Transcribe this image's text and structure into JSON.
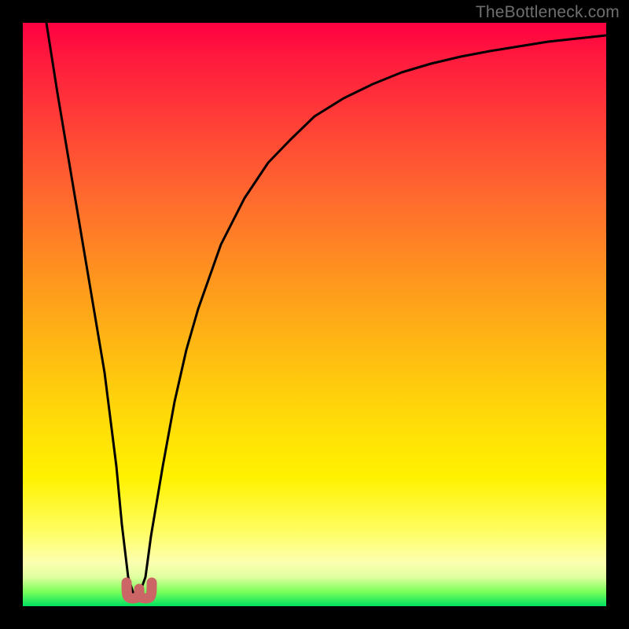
{
  "watermark": "TheBottleneck.com",
  "chart_data": {
    "type": "line",
    "title": "",
    "xlabel": "",
    "ylabel": "",
    "xlim": [
      0,
      100
    ],
    "ylim": [
      0,
      100
    ],
    "grid": false,
    "legend": false,
    "series": [
      {
        "name": "bottleneck-curve",
        "x": [
          4,
          6,
          8,
          10,
          12,
          14,
          16,
          17,
          18,
          19,
          20,
          21,
          22,
          24,
          26,
          28,
          30,
          34,
          38,
          42,
          46,
          50,
          55,
          60,
          65,
          70,
          75,
          80,
          85,
          90,
          95,
          100
        ],
        "y": [
          100,
          88,
          76,
          64,
          52,
          40,
          24,
          14,
          5,
          2,
          2,
          5,
          12,
          24,
          35,
          44,
          51,
          62,
          70,
          76,
          80,
          84,
          87,
          89.5,
          91.5,
          93,
          94.2,
          95.2,
          96,
          96.7,
          97.3,
          97.8
        ]
      }
    ],
    "markers": [
      {
        "name": "min-marker-left",
        "x": 18.5,
        "y": 3.5
      },
      {
        "name": "min-marker-right",
        "x": 20.5,
        "y": 3.5
      }
    ],
    "colors": {
      "curve_stroke": "#000000",
      "marker_fill": "#cc6666",
      "gradient_top": "#ff0040",
      "gradient_bottom": "#00e060"
    }
  }
}
